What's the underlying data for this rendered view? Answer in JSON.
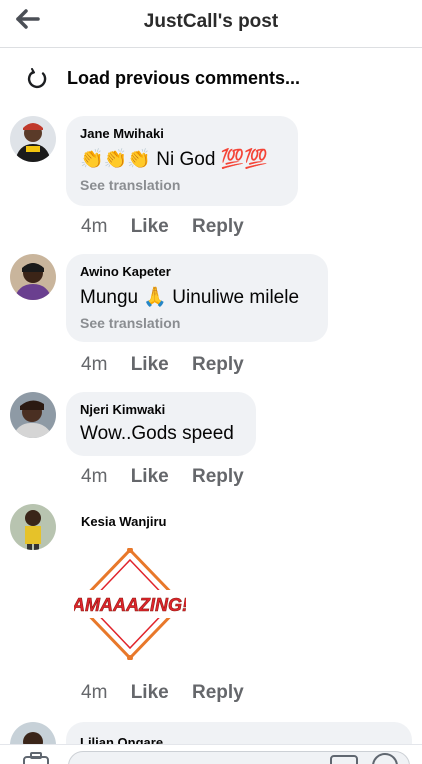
{
  "header": {
    "title": "JustCall's post"
  },
  "load_previous": {
    "label": "Load previous comments..."
  },
  "comments": [
    {
      "author": "Jane Mwihaki",
      "text": "👏👏👏 Ni God 💯💯",
      "see_translation": "See translation",
      "time": "4m",
      "like": "Like",
      "reply": "Reply"
    },
    {
      "author": "Awino Kapeter",
      "text": "Mungu 🙏 Uinuliwe milele",
      "see_translation": "See translation",
      "time": "4m",
      "like": "Like",
      "reply": "Reply"
    },
    {
      "author": "Njeri Kimwaki",
      "text": "Wow..Gods speed",
      "time": "4m",
      "like": "Like",
      "reply": "Reply"
    },
    {
      "author": "Kesia Wanjiru",
      "sticker_text": "AMAAAZING!",
      "time": "4m",
      "like": "Like",
      "reply": "Reply"
    },
    {
      "author": "Lilian Ongare"
    }
  ],
  "colors": {
    "bubble": "#f0f2f5",
    "meta_text": "#65676b",
    "sticker_red": "#e0242c",
    "sticker_orange": "#e8782a"
  }
}
